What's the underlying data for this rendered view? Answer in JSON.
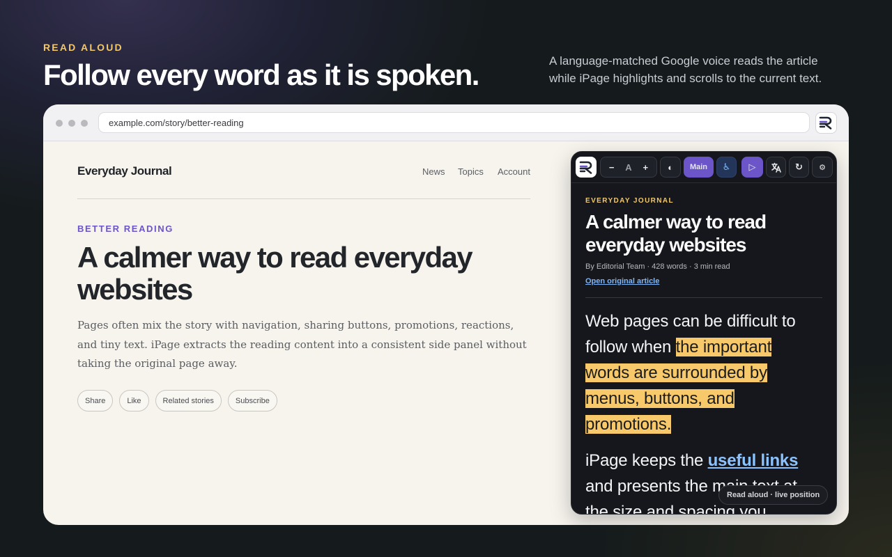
{
  "hero": {
    "eyebrow": "READ ALOUD",
    "headline": "Follow every word as it is spoken.",
    "subcopy": "A language-matched Google voice reads the article while iPage highlights and scrolls to the current text."
  },
  "browser": {
    "url": "example.com/story/better-reading"
  },
  "site": {
    "name": "Everyday Journal",
    "nav": [
      "News",
      "Topics",
      "Account"
    ],
    "kicker": "BETTER READING",
    "title": "A calmer way to read everyday websites",
    "lede": "Pages often mix the story with navigation, sharing buttons, promotions, reactions, and tiny text. iPage extracts the reading content into a consistent side panel without taking the original page away.",
    "actions": [
      "Share",
      "Like",
      "Related stories",
      "Subscribe"
    ]
  },
  "panel": {
    "toolbar": {
      "decrease": "−",
      "font": "A",
      "increase": "+",
      "contrast": "◐",
      "main_label": "Main",
      "accessibility": "♿",
      "play": "▷",
      "refresh": "↻",
      "settings": "⚙"
    },
    "kicker": "EVERYDAY JOURNAL",
    "title": "A calmer way to read everyday websites",
    "meta": "By Editorial Team · 428 words · 3 min read",
    "link": "Open original article",
    "p1_before": "Web pages can be difficult to follow when ",
    "p1_highlight": "the important words are surrounded by menus, buttons, and promotions.",
    "p2_before": "iPage keeps the ",
    "p2_link": "useful links",
    "p2_after": " and presents the main text at the size and spacing you",
    "status": "Read aloud · live position"
  },
  "colors": {
    "accent_yellow": "#f2c86b",
    "accent_purple": "#6b55c8",
    "highlight": "#f8c96a",
    "link_blue": "#8cc3ff"
  }
}
